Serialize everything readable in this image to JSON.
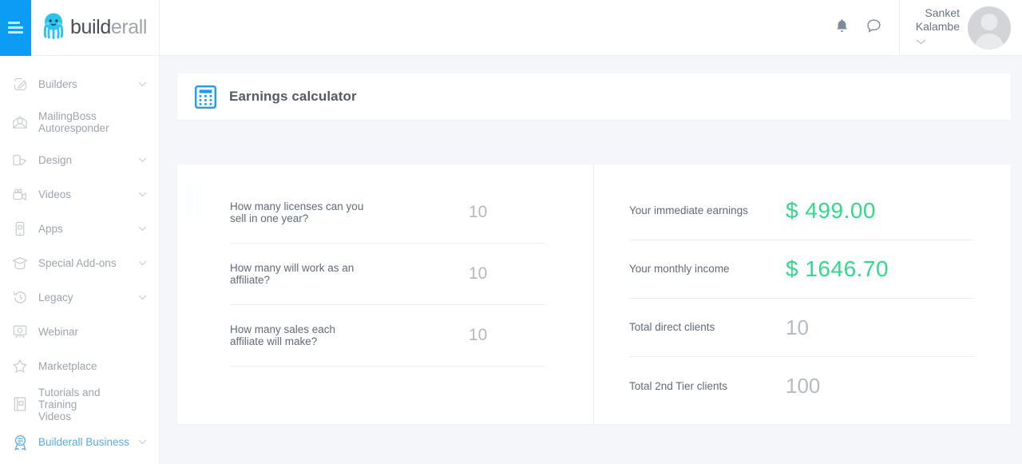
{
  "brand": {
    "name_dark": "build",
    "name_light": "erall",
    "logo_icon": "octopus-logo-icon",
    "menu_icon": "hamburger-menu-icon"
  },
  "sidebar": {
    "items": [
      {
        "label": "Builders",
        "icon": "pencil-square-icon",
        "expandable": true,
        "active": false
      },
      {
        "label": "MailingBoss\nAutoresponder",
        "icon": "envelope-heart-icon",
        "expandable": false,
        "active": false
      },
      {
        "label": "Design",
        "icon": "design-tools-icon",
        "expandable": true,
        "active": false
      },
      {
        "label": "Videos",
        "icon": "video-camera-icon",
        "expandable": true,
        "active": false
      },
      {
        "label": "Apps",
        "icon": "mobile-phone-icon",
        "expandable": true,
        "active": false
      },
      {
        "label": "Special Add-ons",
        "icon": "graduation-cap-icon",
        "expandable": true,
        "active": false
      },
      {
        "label": "Legacy",
        "icon": "clock-rewind-icon",
        "expandable": true,
        "active": false
      },
      {
        "label": "Webinar",
        "icon": "presentation-board-icon",
        "expandable": false,
        "active": false
      },
      {
        "label": "Marketplace",
        "icon": "star-icon",
        "expandable": false,
        "active": false
      },
      {
        "label": "Tutorials and Training\nVideos",
        "icon": "book-icon",
        "expandable": false,
        "active": false
      },
      {
        "label": "Builderall Business",
        "icon": "business-badge-icon",
        "expandable": true,
        "active": true
      }
    ]
  },
  "header": {
    "notifications_icon": "bell-icon",
    "chat_icon": "chat-bubble-icon",
    "caret_icon": "chevron-down-icon",
    "user_name": "Sanket\nKalambe",
    "avatar_icon": "user-avatar-placeholder"
  },
  "page": {
    "title": "Earnings calculator",
    "title_icon": "calculator-icon",
    "accent_blue": "#0c9bf5",
    "accent_green": "#32d98a",
    "background": "#f5f6fa"
  },
  "calculator": {
    "inputs": [
      {
        "question": "How many licenses can you\nsell in one year?",
        "value": "10"
      },
      {
        "question": "How many will work as an\naffiliate?",
        "value": "10"
      },
      {
        "question": "How many sales each\naffiliate will make?",
        "value": "10"
      }
    ],
    "results": [
      {
        "label": "Your immediate earnings",
        "value": "$ 499.00",
        "style": "money"
      },
      {
        "label": "Your monthly income",
        "value": "$ 1646.70",
        "style": "money"
      },
      {
        "label": "Total direct clients",
        "value": "10",
        "style": "plain"
      },
      {
        "label": "Total 2nd Tier clients",
        "value": "100",
        "style": "plain"
      }
    ]
  }
}
